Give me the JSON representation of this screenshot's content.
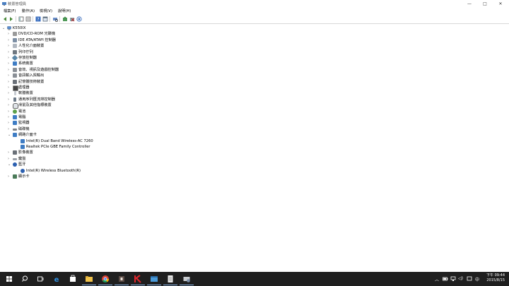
{
  "window": {
    "title": "裝置管理員",
    "min": "—",
    "max": "□",
    "close": "✕"
  },
  "menu": [
    "檔案(F)",
    "動作(A)",
    "檢視(V)",
    "說明(H)"
  ],
  "tree": {
    "root": "K550IX",
    "items": [
      {
        "label": "DVD/CD-ROM 光碟機",
        "icon": "dvd-drive-icon",
        "expanded": false
      },
      {
        "label": "IDE ATA/ATAPI 控制器",
        "icon": "ide-controller-icon",
        "expanded": false
      },
      {
        "label": "人性化介面裝置",
        "icon": "hid-icon",
        "expanded": false
      },
      {
        "label": "列印佇列",
        "icon": "print-queue-icon",
        "expanded": false
      },
      {
        "label": "存放控制器",
        "icon": "storage-controller-icon",
        "expanded": false
      },
      {
        "label": "系統裝置",
        "icon": "system-devices-icon",
        "expanded": false
      },
      {
        "label": "音效、視訊及遊戲控制器",
        "icon": "sound-icon",
        "expanded": false
      },
      {
        "label": "音訊輸入與輸出",
        "icon": "audio-io-icon",
        "expanded": false
      },
      {
        "label": "記憶體技術裝置",
        "icon": "memory-tech-icon",
        "expanded": false
      },
      {
        "label": "處理器",
        "icon": "processor-icon",
        "expanded": false
      },
      {
        "label": "軟體裝置",
        "icon": "software-device-icon",
        "expanded": false
      },
      {
        "label": "通用序列匯流排控制器",
        "icon": "usb-controller-icon",
        "expanded": false
      },
      {
        "label": "滑鼠及其他指標裝置",
        "icon": "mouse-icon",
        "expanded": false
      },
      {
        "label": "電池",
        "icon": "battery-icon",
        "expanded": false
      },
      {
        "label": "電腦",
        "icon": "computer-icon",
        "expanded": false
      },
      {
        "label": "監視器",
        "icon": "monitor-icon",
        "expanded": false
      },
      {
        "label": "磁碟機",
        "icon": "disk-drive-icon",
        "expanded": false
      },
      {
        "label": "網路介面卡",
        "icon": "network-adapter-icon",
        "expanded": true,
        "children": [
          "Intel(R) Dual Band Wireless-AC 7260",
          "Realtek PCIe GBE Family Controller"
        ]
      },
      {
        "label": "影像裝置",
        "icon": "imaging-icon",
        "expanded": false
      },
      {
        "label": "鍵盤",
        "icon": "keyboard-icon",
        "expanded": false
      },
      {
        "label": "藍牙",
        "icon": "bluetooth-icon",
        "expanded": true,
        "children": [
          "Intel(R) Wireless Bluetooth(R)"
        ]
      },
      {
        "label": "顯示卡",
        "icon": "display-adapter-icon",
        "expanded": false
      }
    ]
  },
  "clock": {
    "time": "下午 09:44",
    "date": "2015/8/15"
  },
  "tray": {
    "lang": "中"
  },
  "colors": {
    "taskbar": "#1f1f1f",
    "accent": "#2b78c5"
  }
}
